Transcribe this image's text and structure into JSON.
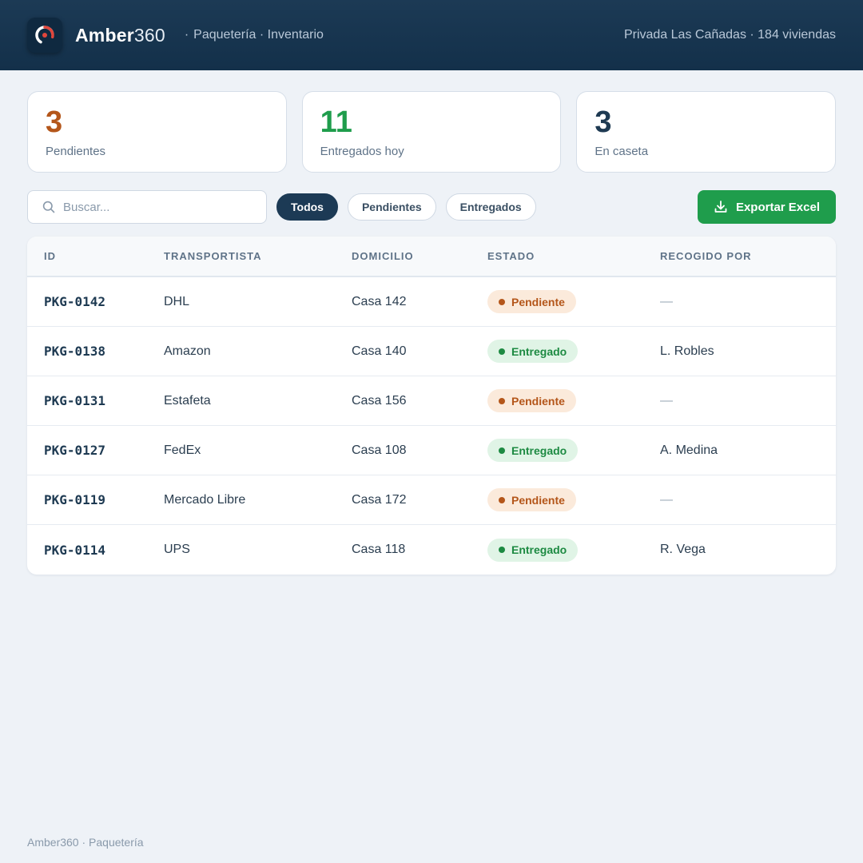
{
  "header": {
    "brand_bold": "Amber",
    "brand_light": "360",
    "subtitle_dot": "·",
    "subtitle": "Paquetería · Inventario",
    "site_info": "Privada Las Cañadas · 184 viviendas"
  },
  "stats": [
    {
      "value": "3",
      "label": "Pendientes",
      "color": "#b4561a"
    },
    {
      "value": "11",
      "label": "Entregados hoy",
      "color": "#1f9d4c"
    },
    {
      "value": "3",
      "label": "En caseta",
      "color": "#1e3a52"
    }
  ],
  "toolbar": {
    "search_placeholder": "Buscar...",
    "filters": [
      "Todos",
      "Pendientes",
      "Entregados"
    ],
    "active_filter": "Todos",
    "export_label": "Exportar Excel"
  },
  "table": {
    "headers": [
      "ID",
      "TRANSPORTISTA",
      "DOMICILIO",
      "ESTADO",
      "RECOGIDO POR"
    ],
    "rows": [
      {
        "id": "PKG-0142",
        "carrier": "DHL",
        "address": "Casa 142",
        "status": "Pendiente",
        "picked_by": "—"
      },
      {
        "id": "PKG-0138",
        "carrier": "Amazon",
        "address": "Casa 140",
        "status": "Entregado",
        "picked_by": "L. Robles"
      },
      {
        "id": "PKG-0131",
        "carrier": "Estafeta",
        "address": "Casa 156",
        "status": "Pendiente",
        "picked_by": "—"
      },
      {
        "id": "PKG-0127",
        "carrier": "FedEx",
        "address": "Casa 108",
        "status": "Entregado",
        "picked_by": "A. Medina"
      },
      {
        "id": "PKG-0119",
        "carrier": "Mercado Libre",
        "address": "Casa 172",
        "status": "Pendiente",
        "picked_by": "—"
      },
      {
        "id": "PKG-0114",
        "carrier": "UPS",
        "address": "Casa 118",
        "status": "Entregado",
        "picked_by": "R. Vega"
      }
    ]
  },
  "footer": {
    "text": "Amber360 · Paquetería"
  },
  "colors": {
    "header_bg": "#1c3a55",
    "accent_pending": "#b4561a",
    "accent_delivered": "#1d8a42",
    "export_green": "#1f9d4c",
    "logo_ring_red": "#e0463c"
  }
}
